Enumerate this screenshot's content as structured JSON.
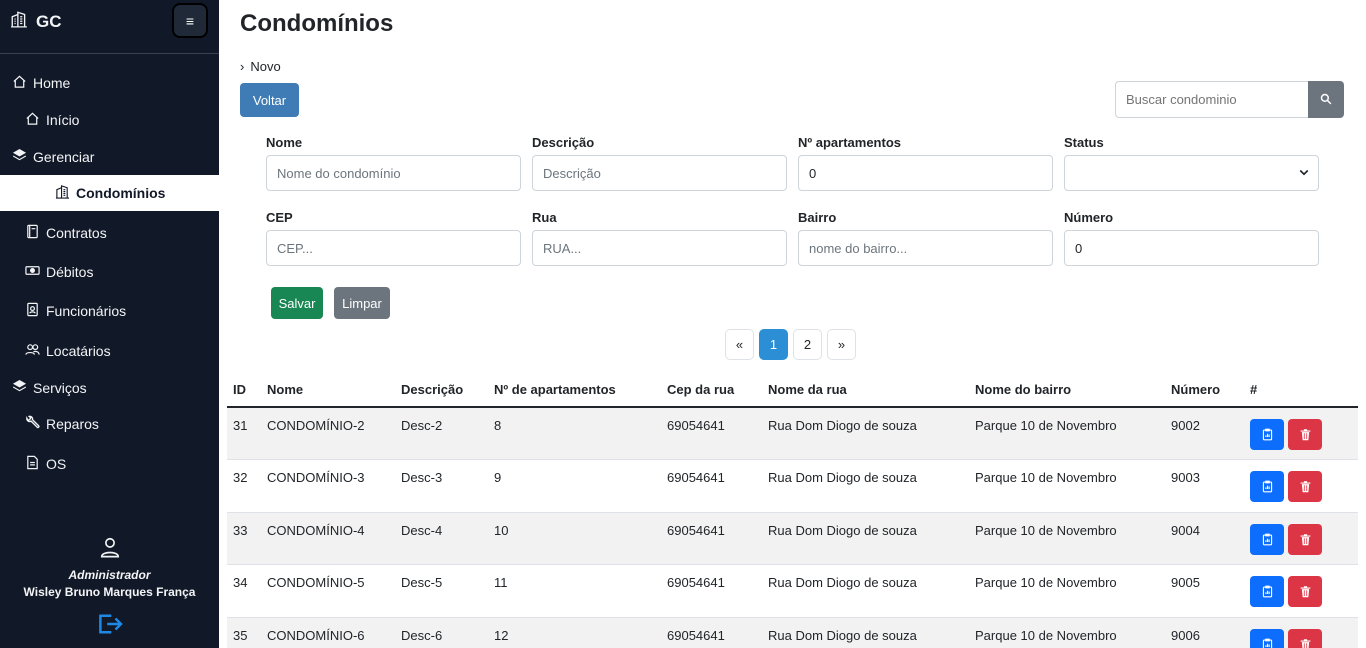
{
  "sidebar": {
    "brand": "GC",
    "toggle_icon": "≡",
    "items": [
      {
        "label": "Home",
        "icon": "home-icon"
      },
      {
        "label": "Início",
        "icon": "home-icon"
      },
      {
        "label": "Gerenciar",
        "icon": "layers-icon"
      },
      {
        "label": "Condomínios",
        "icon": "building-icon"
      },
      {
        "label": "Contratos",
        "icon": "book-icon"
      },
      {
        "label": "Débitos",
        "icon": "cash-icon"
      },
      {
        "label": "Funcionários",
        "icon": "badge-icon"
      },
      {
        "label": "Locatários",
        "icon": "people-icon"
      },
      {
        "label": "Serviços",
        "icon": "layers-icon"
      },
      {
        "label": "Reparos",
        "icon": "wrench-icon"
      },
      {
        "label": "OS",
        "icon": "document-icon"
      }
    ],
    "user": {
      "role": "Administrador",
      "name": "Wisley Bruno Marques França"
    }
  },
  "page": {
    "title": "Condomínios",
    "crumb": "Novo",
    "voltar_label": "Voltar",
    "search_placeholder": "Buscar condominio"
  },
  "form": {
    "nome": {
      "label": "Nome",
      "placeholder": "Nome do condomínio"
    },
    "descricao": {
      "label": "Descrição",
      "placeholder": "Descrição"
    },
    "apartamentos": {
      "label": "Nº apartamentos",
      "value": "0"
    },
    "status": {
      "label": "Status",
      "value": ""
    },
    "cep": {
      "label": "CEP",
      "placeholder": "CEP..."
    },
    "rua": {
      "label": "Rua",
      "placeholder": "RUA..."
    },
    "bairro": {
      "label": "Bairro",
      "placeholder": "nome do bairro..."
    },
    "numero": {
      "label": "Número",
      "value": "0"
    },
    "salvar_label": "Salvar",
    "limpar_label": "Limpar"
  },
  "pagination": {
    "prev": "«",
    "pages": [
      "1",
      "2"
    ],
    "current": "1",
    "next": "»"
  },
  "table": {
    "headers": [
      "ID",
      "Nome",
      "Descrição",
      "Nº de apartamentos",
      "Cep da rua",
      "Nome da rua",
      "Nome do bairro",
      "Número",
      "#"
    ],
    "rows": [
      [
        "31",
        "CONDOMÍNIO-2",
        "Desc-2",
        "8",
        "69054641",
        "Rua Dom Diogo de souza",
        "Parque 10 de Novembro",
        "9002"
      ],
      [
        "32",
        "CONDOMÍNIO-3",
        "Desc-3",
        "9",
        "69054641",
        "Rua Dom Diogo de souza",
        "Parque 10 de Novembro",
        "9003"
      ],
      [
        "33",
        "CONDOMÍNIO-4",
        "Desc-4",
        "10",
        "69054641",
        "Rua Dom Diogo de souza",
        "Parque 10 de Novembro",
        "9004"
      ],
      [
        "34",
        "CONDOMÍNIO-5",
        "Desc-5",
        "11",
        "69054641",
        "Rua Dom Diogo de souza",
        "Parque 10 de Novembro",
        "9005"
      ],
      [
        "35",
        "CONDOMÍNIO-6",
        "Desc-6",
        "12",
        "69054641",
        "Rua Dom Diogo de souza",
        "Parque 10 de Novembro",
        "9006"
      ]
    ]
  },
  "colors": {
    "sidebar_bg": "#111827",
    "primary": "#3f7bb5",
    "success": "#198754",
    "danger": "#dc3545",
    "secondary": "#6c757d"
  }
}
